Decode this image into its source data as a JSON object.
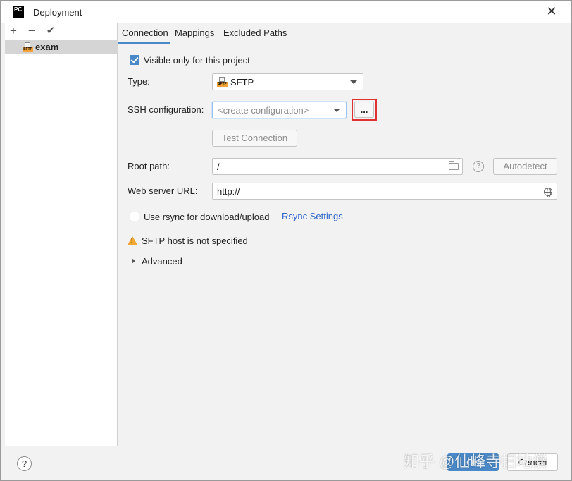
{
  "window": {
    "title": "Deployment",
    "app_icon_text": "PC"
  },
  "left_pane": {
    "toolbar": {
      "add": "+",
      "remove": "−",
      "apply": "✔"
    },
    "servers": [
      {
        "label": "exam",
        "icon": "sftp-server-icon",
        "selected": true
      }
    ]
  },
  "tabs": [
    {
      "label": "Connection",
      "active": true
    },
    {
      "label": "Mappings",
      "active": false
    },
    {
      "label": "Excluded Paths",
      "active": false
    }
  ],
  "connection": {
    "visible_only_label": "Visible only for this project",
    "visible_only_checked": true,
    "type_label": "Type:",
    "type_value": "SFTP",
    "ssh_label": "SSH configuration:",
    "ssh_placeholder": "<create configuration>",
    "browse_label": "...",
    "test_connection_label": "Test Connection",
    "root_path_label": "Root path:",
    "root_path_value": "/",
    "autodetect_label": "Autodetect",
    "help_mark": "?",
    "web_url_label": "Web server URL:",
    "web_url_value": "http://",
    "rsync_label": "Use rsync for download/upload",
    "rsync_checked": false,
    "rsync_settings_link": "Rsync Settings",
    "warning_text": "SFTP host is not specified",
    "advanced_label": "Advanced"
  },
  "footer": {
    "help_label": "?",
    "ok_label": "OK",
    "cancel_label": "Cancel",
    "watermark": "知乎 @仙峰寺扫地僧"
  },
  "colors": {
    "accent": "#4a88c7",
    "highlight": "#e03030",
    "link": "#2f65ca",
    "warning": "#f0a732"
  }
}
